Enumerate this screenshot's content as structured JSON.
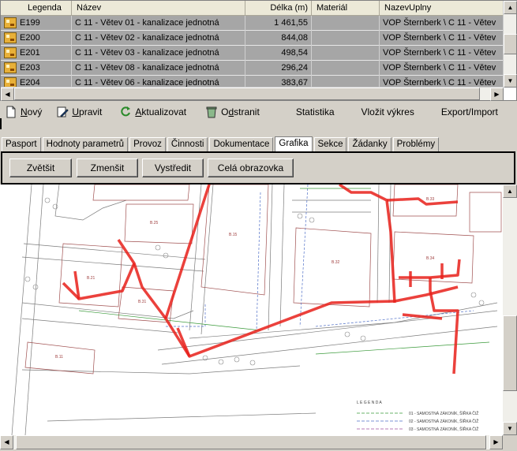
{
  "grid": {
    "columns": [
      "Legenda",
      "Název",
      "Délka (m)",
      "Materiál",
      "NazevUplny"
    ],
    "rows": [
      {
        "legenda": "E199",
        "nazev": "C 11 - Větev 01 - kanalizace jednotná",
        "delka": "1 461,55",
        "material": "",
        "nazev_uplny": "VOP Šternberk \\ C 11 - Větev"
      },
      {
        "legenda": "E200",
        "nazev": "C 11 - Větev 02 - kanalizace jednotná",
        "delka": "844,08",
        "material": "",
        "nazev_uplny": "VOP Šternberk \\ C 11 - Větev"
      },
      {
        "legenda": "E201",
        "nazev": "C 11 - Větev 03 - kanalizace jednotná",
        "delka": "498,54",
        "material": "",
        "nazev_uplny": "VOP Šternberk \\ C 11 - Větev"
      },
      {
        "legenda": "E203",
        "nazev": "C 11 - Větev 08 - kanalizace jednotná",
        "delka": "296,24",
        "material": "",
        "nazev_uplny": "VOP Šternberk \\ C 11 - Větev"
      },
      {
        "legenda": "E204",
        "nazev": "C 11 - Větev 06 - kanalizace jednotná",
        "delka": "383,67",
        "material": "",
        "nazev_uplny": "VOP Šternberk \\ C 11 - Větev"
      }
    ]
  },
  "toolbar": {
    "new_pre": "",
    "new_u": "N",
    "new_post": "ový",
    "edit_pre": "",
    "edit_u": "U",
    "edit_post": "pravit",
    "refresh_pre": "",
    "refresh_u": "A",
    "refresh_post": "ktualizovat",
    "delete_pre": "O",
    "delete_u": "d",
    "delete_post": "stranit",
    "statistics": "Statistika",
    "insert_drawing": "Vložit výkres",
    "export_import": "Export/Import"
  },
  "tabs": [
    "Pasport",
    "Hodnoty parametrů",
    "Provoz",
    "Činnosti",
    "Dokumentace",
    "Grafika",
    "Sekce",
    "Žádanky",
    "Problémy"
  ],
  "active_tab": "Grafika",
  "graphics_buttons": {
    "zoom_in": "Zvětšit",
    "zoom_out": "Zmenšit",
    "center": "Vystředit",
    "fullscreen": "Celá obrazovka"
  },
  "map": {
    "legend_title": "L E G E N D A",
    "legend_items": [
      "01 - SAMOSTNÁ ZÁKONÍK, ŠÍŘKA ČIŽ",
      "02 - SAMOSTNÁ ZÁKONÍK, ŠÍŘKA ČIŽ",
      "03 - SAMOSTNÁ ZÁKONÍK, ŠÍŘKA ČIŽ"
    ],
    "sewer_color": "#e8201a"
  }
}
